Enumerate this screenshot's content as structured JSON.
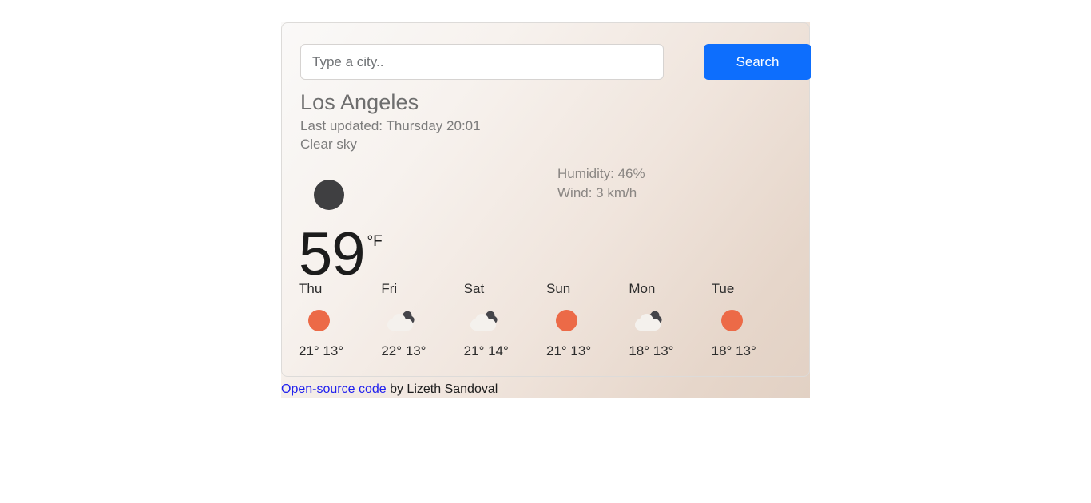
{
  "search": {
    "placeholder": "Type a city..",
    "value": "",
    "button_label": "Search"
  },
  "current": {
    "city": "Los Angeles",
    "last_updated": "Last updated: Thursday 20:01",
    "condition": "Clear sky",
    "humidity": "Humidity: 46%",
    "wind": "Wind: 3 km/h",
    "temperature": "59",
    "unit": "°F",
    "icon": "dark-circle-icon"
  },
  "forecast": [
    {
      "day": "Thu",
      "icon": "sun-icon",
      "temps": "21° 13°"
    },
    {
      "day": "Fri",
      "icon": "cloud-icon",
      "temps": "22° 13°"
    },
    {
      "day": "Sat",
      "icon": "cloud-icon",
      "temps": "21° 14°"
    },
    {
      "day": "Sun",
      "icon": "sun-icon",
      "temps": "21° 13°"
    },
    {
      "day": "Mon",
      "icon": "cloud-icon",
      "temps": "18° 13°"
    },
    {
      "day": "Tue",
      "icon": "sun-icon",
      "temps": "18° 13°"
    }
  ],
  "footer": {
    "link_text": "Open-source code",
    "tail_text": " by Lizeth Sandoval"
  },
  "colors": {
    "accent_blue": "#0d6efd",
    "sun_orange": "#ec6a47",
    "icon_dark": "#3f3f41",
    "link_blue": "#2020ee",
    "card_border": "#dddbd9"
  }
}
